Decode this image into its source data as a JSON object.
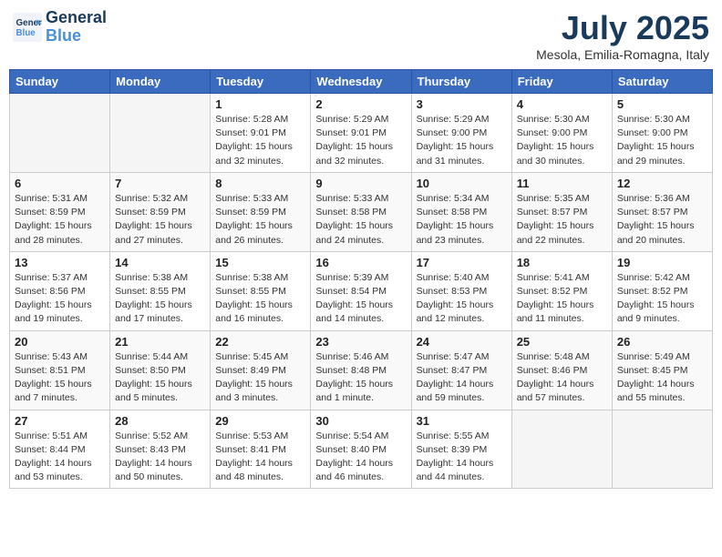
{
  "header": {
    "logo_line1": "General",
    "logo_line2": "Blue",
    "month_year": "July 2025",
    "location": "Mesola, Emilia-Romagna, Italy"
  },
  "weekdays": [
    "Sunday",
    "Monday",
    "Tuesday",
    "Wednesday",
    "Thursday",
    "Friday",
    "Saturday"
  ],
  "weeks": [
    [
      {
        "day": "",
        "info": ""
      },
      {
        "day": "",
        "info": ""
      },
      {
        "day": "1",
        "info": "Sunrise: 5:28 AM\nSunset: 9:01 PM\nDaylight: 15 hours and 32 minutes."
      },
      {
        "day": "2",
        "info": "Sunrise: 5:29 AM\nSunset: 9:01 PM\nDaylight: 15 hours and 32 minutes."
      },
      {
        "day": "3",
        "info": "Sunrise: 5:29 AM\nSunset: 9:00 PM\nDaylight: 15 hours and 31 minutes."
      },
      {
        "day": "4",
        "info": "Sunrise: 5:30 AM\nSunset: 9:00 PM\nDaylight: 15 hours and 30 minutes."
      },
      {
        "day": "5",
        "info": "Sunrise: 5:30 AM\nSunset: 9:00 PM\nDaylight: 15 hours and 29 minutes."
      }
    ],
    [
      {
        "day": "6",
        "info": "Sunrise: 5:31 AM\nSunset: 8:59 PM\nDaylight: 15 hours and 28 minutes."
      },
      {
        "day": "7",
        "info": "Sunrise: 5:32 AM\nSunset: 8:59 PM\nDaylight: 15 hours and 27 minutes."
      },
      {
        "day": "8",
        "info": "Sunrise: 5:33 AM\nSunset: 8:59 PM\nDaylight: 15 hours and 26 minutes."
      },
      {
        "day": "9",
        "info": "Sunrise: 5:33 AM\nSunset: 8:58 PM\nDaylight: 15 hours and 24 minutes."
      },
      {
        "day": "10",
        "info": "Sunrise: 5:34 AM\nSunset: 8:58 PM\nDaylight: 15 hours and 23 minutes."
      },
      {
        "day": "11",
        "info": "Sunrise: 5:35 AM\nSunset: 8:57 PM\nDaylight: 15 hours and 22 minutes."
      },
      {
        "day": "12",
        "info": "Sunrise: 5:36 AM\nSunset: 8:57 PM\nDaylight: 15 hours and 20 minutes."
      }
    ],
    [
      {
        "day": "13",
        "info": "Sunrise: 5:37 AM\nSunset: 8:56 PM\nDaylight: 15 hours and 19 minutes."
      },
      {
        "day": "14",
        "info": "Sunrise: 5:38 AM\nSunset: 8:55 PM\nDaylight: 15 hours and 17 minutes."
      },
      {
        "day": "15",
        "info": "Sunrise: 5:38 AM\nSunset: 8:55 PM\nDaylight: 15 hours and 16 minutes."
      },
      {
        "day": "16",
        "info": "Sunrise: 5:39 AM\nSunset: 8:54 PM\nDaylight: 15 hours and 14 minutes."
      },
      {
        "day": "17",
        "info": "Sunrise: 5:40 AM\nSunset: 8:53 PM\nDaylight: 15 hours and 12 minutes."
      },
      {
        "day": "18",
        "info": "Sunrise: 5:41 AM\nSunset: 8:52 PM\nDaylight: 15 hours and 11 minutes."
      },
      {
        "day": "19",
        "info": "Sunrise: 5:42 AM\nSunset: 8:52 PM\nDaylight: 15 hours and 9 minutes."
      }
    ],
    [
      {
        "day": "20",
        "info": "Sunrise: 5:43 AM\nSunset: 8:51 PM\nDaylight: 15 hours and 7 minutes."
      },
      {
        "day": "21",
        "info": "Sunrise: 5:44 AM\nSunset: 8:50 PM\nDaylight: 15 hours and 5 minutes."
      },
      {
        "day": "22",
        "info": "Sunrise: 5:45 AM\nSunset: 8:49 PM\nDaylight: 15 hours and 3 minutes."
      },
      {
        "day": "23",
        "info": "Sunrise: 5:46 AM\nSunset: 8:48 PM\nDaylight: 15 hours and 1 minute."
      },
      {
        "day": "24",
        "info": "Sunrise: 5:47 AM\nSunset: 8:47 PM\nDaylight: 14 hours and 59 minutes."
      },
      {
        "day": "25",
        "info": "Sunrise: 5:48 AM\nSunset: 8:46 PM\nDaylight: 14 hours and 57 minutes."
      },
      {
        "day": "26",
        "info": "Sunrise: 5:49 AM\nSunset: 8:45 PM\nDaylight: 14 hours and 55 minutes."
      }
    ],
    [
      {
        "day": "27",
        "info": "Sunrise: 5:51 AM\nSunset: 8:44 PM\nDaylight: 14 hours and 53 minutes."
      },
      {
        "day": "28",
        "info": "Sunrise: 5:52 AM\nSunset: 8:43 PM\nDaylight: 14 hours and 50 minutes."
      },
      {
        "day": "29",
        "info": "Sunrise: 5:53 AM\nSunset: 8:41 PM\nDaylight: 14 hours and 48 minutes."
      },
      {
        "day": "30",
        "info": "Sunrise: 5:54 AM\nSunset: 8:40 PM\nDaylight: 14 hours and 46 minutes."
      },
      {
        "day": "31",
        "info": "Sunrise: 5:55 AM\nSunset: 8:39 PM\nDaylight: 14 hours and 44 minutes."
      },
      {
        "day": "",
        "info": ""
      },
      {
        "day": "",
        "info": ""
      }
    ]
  ]
}
